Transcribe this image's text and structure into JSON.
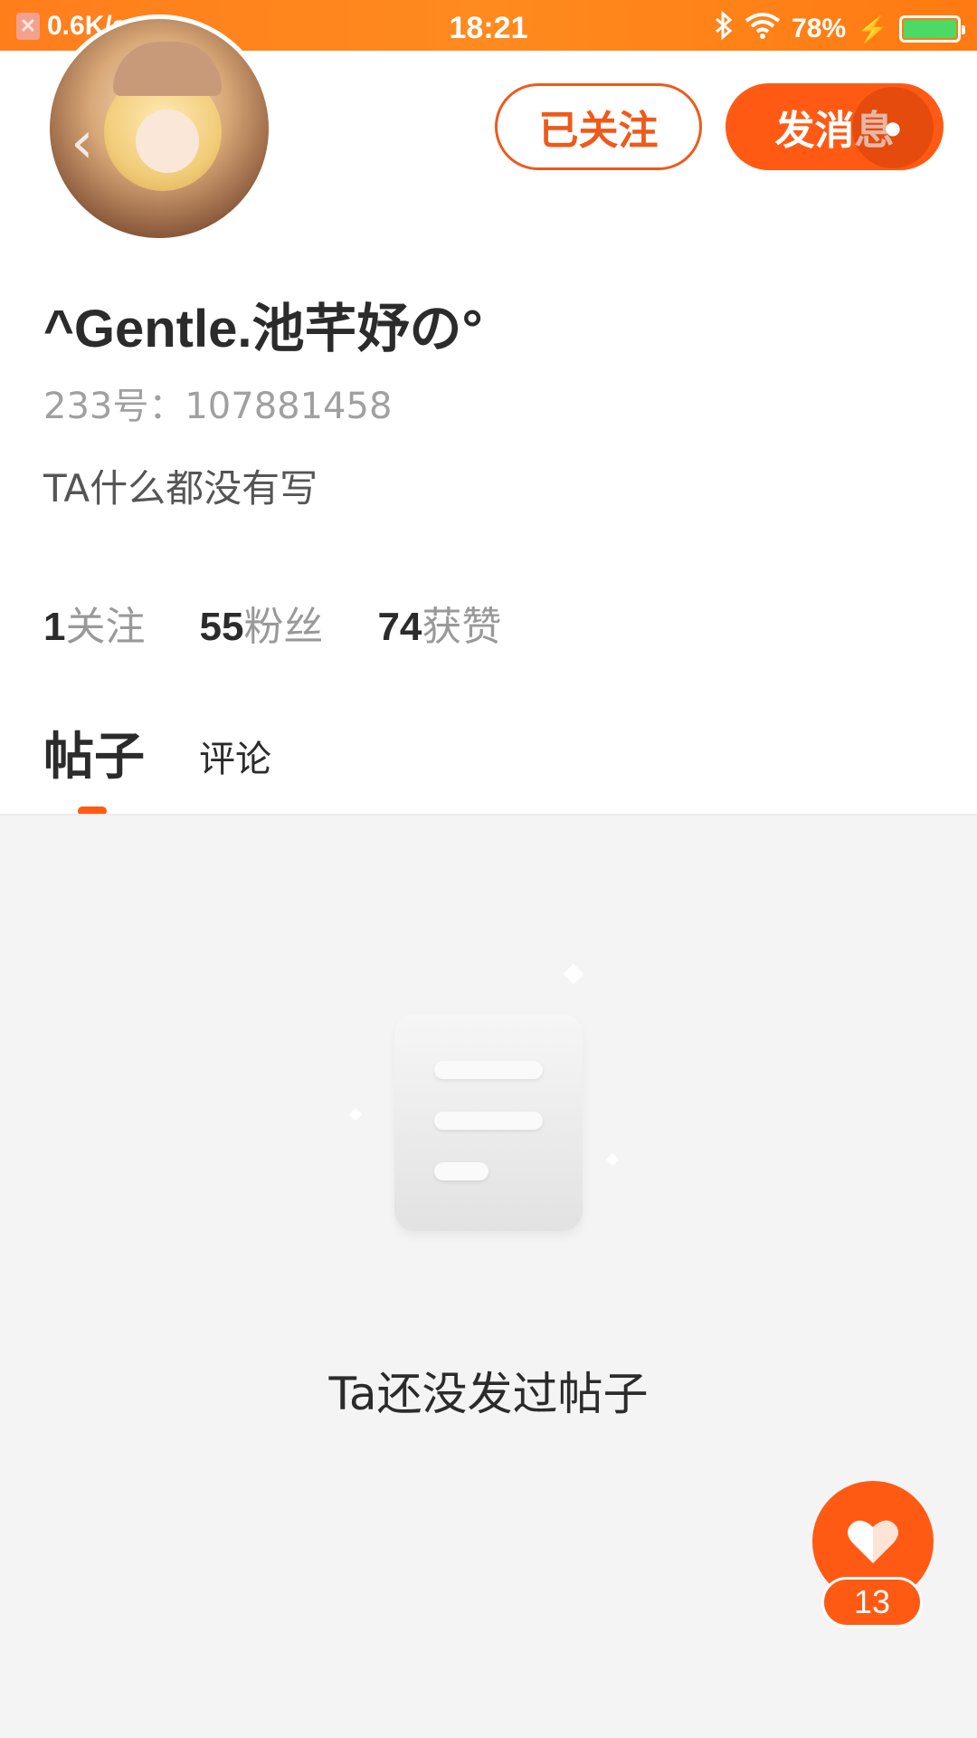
{
  "status_bar": {
    "net_speed": "0.6K/s",
    "dots": "···",
    "time": "18:21",
    "battery": "78%"
  },
  "profile": {
    "followed_label": "已关注",
    "message_label": "发消息",
    "username": "^Gentle.池芊妤の°",
    "id_text": "233号：107881458",
    "bio": "TA什么都没有写"
  },
  "stats": [
    {
      "value": "1",
      "label": "关注"
    },
    {
      "value": "55",
      "label": "粉丝"
    },
    {
      "value": "74",
      "label": "获赞"
    }
  ],
  "tabs": {
    "posts": "帖子",
    "comments": "评论",
    "active": "posts"
  },
  "empty_state": {
    "message": "Ta还没发过帖子"
  },
  "like": {
    "count": "13"
  },
  "colors": {
    "accent": "#ff5a14",
    "status_bar": "#ff7e1c"
  }
}
